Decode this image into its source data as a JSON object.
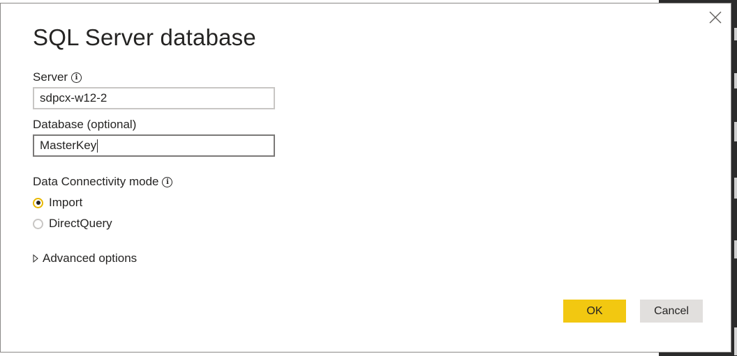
{
  "dialog": {
    "title": "SQL Server database",
    "server": {
      "label": "Server",
      "value": "sdpcx-w12-2"
    },
    "database": {
      "label": "Database (optional)",
      "value": "MasterKey"
    },
    "connectivity": {
      "label": "Data Connectivity mode",
      "options": [
        {
          "label": "Import",
          "selected": true
        },
        {
          "label": "DirectQuery",
          "selected": false
        }
      ]
    },
    "advanced_label": "Advanced options",
    "ok_label": "OK",
    "cancel_label": "Cancel"
  },
  "colors": {
    "accent": "#F2C811",
    "cancel_bg": "#E1DFDD",
    "text": "#252423"
  },
  "icons": {
    "close": "close-icon",
    "info": "info-icon",
    "expand": "triangle-right-icon"
  }
}
